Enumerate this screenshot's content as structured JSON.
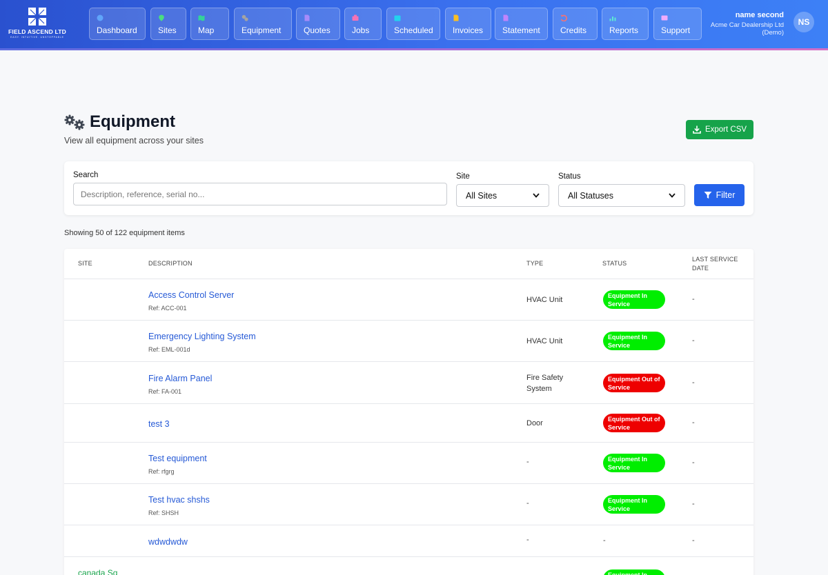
{
  "brand": {
    "name": "FIELD ASCEND LTD",
    "tagline": "EASY. INTUITIVE. UNSTOPPABLE"
  },
  "nav": [
    {
      "label": "Dashboard",
      "icon": "gauge-icon",
      "color": "#60a5fa"
    },
    {
      "label": "Sites",
      "icon": "map-pin-icon",
      "color": "#4ade80"
    },
    {
      "label": "Map",
      "icon": "map-icon",
      "color": "#34d399"
    },
    {
      "label": "Equipment",
      "icon": "gears-icon",
      "color": "#a3a3a3"
    },
    {
      "label": "Quotes",
      "icon": "document-icon",
      "color": "#a78bfa"
    },
    {
      "label": "Jobs",
      "icon": "briefcase-icon",
      "color": "#f472b6"
    },
    {
      "label": "Scheduled",
      "icon": "calendar-icon",
      "color": "#22d3ee"
    },
    {
      "label": "Invoices",
      "icon": "invoice-icon",
      "color": "#fbbf24"
    },
    {
      "label": "Statement",
      "icon": "statement-icon",
      "color": "#c084fc"
    },
    {
      "label": "Credits",
      "icon": "undo-icon",
      "color": "#f87171"
    },
    {
      "label": "Reports",
      "icon": "chart-icon",
      "color": "#5eead4"
    },
    {
      "label": "Support",
      "icon": "envelope-icon",
      "color": "#f0abfc"
    }
  ],
  "user": {
    "name": "name second",
    "org": "Acme Car Dealership Ltd",
    "mode": "(Demo)",
    "initials": "NS"
  },
  "page": {
    "title": "Equipment",
    "subtitle": "View all equipment across your sites",
    "export_label": "Export CSV"
  },
  "filters": {
    "search_label": "Search",
    "search_placeholder": "Description, reference, serial no...",
    "site_label": "Site",
    "site_value": "All Sites",
    "status_label": "Status",
    "status_value": "All Statuses",
    "filter_label": "Filter"
  },
  "showing": "Showing 50 of 122 equipment items",
  "table": {
    "headers": {
      "site": "SITE",
      "description": "DESCRIPTION",
      "type": "TYPE",
      "status": "STATUS",
      "last_service": "LAST SERVICE DATE"
    },
    "rows": [
      {
        "site": "",
        "description": "Access Control Server",
        "ref": "Ref: ACC-001",
        "type": "HVAC Unit",
        "status": "Equipment In Service",
        "status_kind": "in",
        "last_service": "-"
      },
      {
        "site": "",
        "description": "Emergency Lighting System",
        "ref": "Ref: EML-001d",
        "type": "HVAC Unit",
        "status": "Equipment In Service",
        "status_kind": "in",
        "last_service": "-"
      },
      {
        "site": "",
        "description": "Fire Alarm Panel",
        "ref": "Ref: FA-001",
        "type": "Fire Safety System",
        "status": "Equipment Out of Service",
        "status_kind": "out",
        "last_service": "-"
      },
      {
        "site": "",
        "description": "test 3",
        "ref": "",
        "type": "Door",
        "status": "Equipment Out of Service",
        "status_kind": "out",
        "last_service": "-"
      },
      {
        "site": "",
        "description": "Test equipment",
        "ref": "Ref: rfgrg",
        "type": "-",
        "status": "Equipment In Service",
        "status_kind": "in",
        "last_service": "-"
      },
      {
        "site": "",
        "description": "Test hvac shshs",
        "ref": "Ref: SHSH",
        "type": "-",
        "status": "Equipment In Service",
        "status_kind": "in",
        "last_service": "-"
      },
      {
        "site": "",
        "description": "wdwdwdw",
        "ref": "",
        "type": "-",
        "status": "-",
        "status_kind": "none",
        "last_service": "-"
      },
      {
        "site": "canada Sq",
        "description": "",
        "ref": "",
        "type": "",
        "status": "Equipment In Service",
        "status_kind": "in",
        "last_service": ""
      }
    ]
  },
  "colors": {
    "accent": "#2563eb",
    "export": "#16a34a",
    "in_service": "#00ee00",
    "out_of_service": "#ee0000",
    "link": "#2559d6"
  }
}
